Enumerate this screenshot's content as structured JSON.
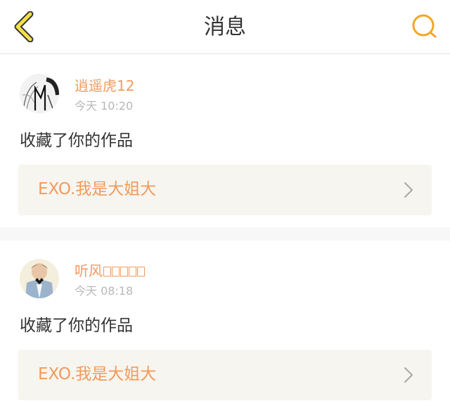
{
  "header": {
    "title": "消息",
    "back_icon": "chevron-left-icon",
    "search_icon": "search-icon",
    "accent_color": "#f5a623"
  },
  "notifications": [
    {
      "username": "逍遥虎12",
      "time": "今天 10:20",
      "action": "收藏了你的作品",
      "work_title": "EXO.我是大姐大"
    },
    {
      "username": "听风",
      "time": "今天 08:18",
      "action": "收藏了你的作品",
      "work_title": "EXO.我是大姐大"
    }
  ],
  "colors": {
    "username": "#f29a5c",
    "work_title": "#f29a5c",
    "work_box_bg": "#f6f5ef",
    "timestamp": "#b8b8b8"
  }
}
